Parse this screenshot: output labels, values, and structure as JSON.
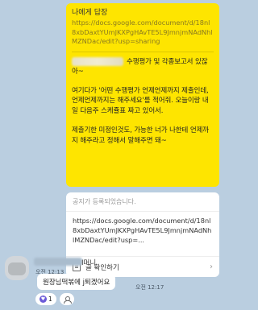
{
  "my_message": {
    "reply_header": "나에게 답장",
    "reply_url": "https://docs.google.com/document/d/18nl8xbDaxtYUmJKXPgHAvTE5L9JmnjmNAdNhlMZNDac/edit?usp=sharing",
    "after_blur": "수행평가 및 각종보고서 있잖아~",
    "body": "여기다가 '어떤 수행평가 언제언제까지 제출인데, 언제언제까지는 해주세요'를 적어줘. 오늘이랑 내일 다음주 스케쥴표 짜고 있어서.\n\n제출기한 미정인것도, 가능한 너가 나한테 언제까지 해주라고 정해서 말해주면 돼~"
  },
  "notice": {
    "header": "공지가 등록되었습니다.",
    "url": "https://docs.google.com/document/d/18nl8xbDaxtYUmJKXPgHAvTE5L9JmnjmNAdNhlMZNDac/edit?usp=...",
    "action": "글 확인하기",
    "time": "오전 12:13"
  },
  "other_message": {
    "sender_suffix": "I머니",
    "text": "원장님떡볶에 j퇴겠어요",
    "time": "오전 12:17",
    "reaction_count": "1"
  },
  "colors": {
    "background": "#bacee0",
    "my_bubble": "#fee500"
  }
}
